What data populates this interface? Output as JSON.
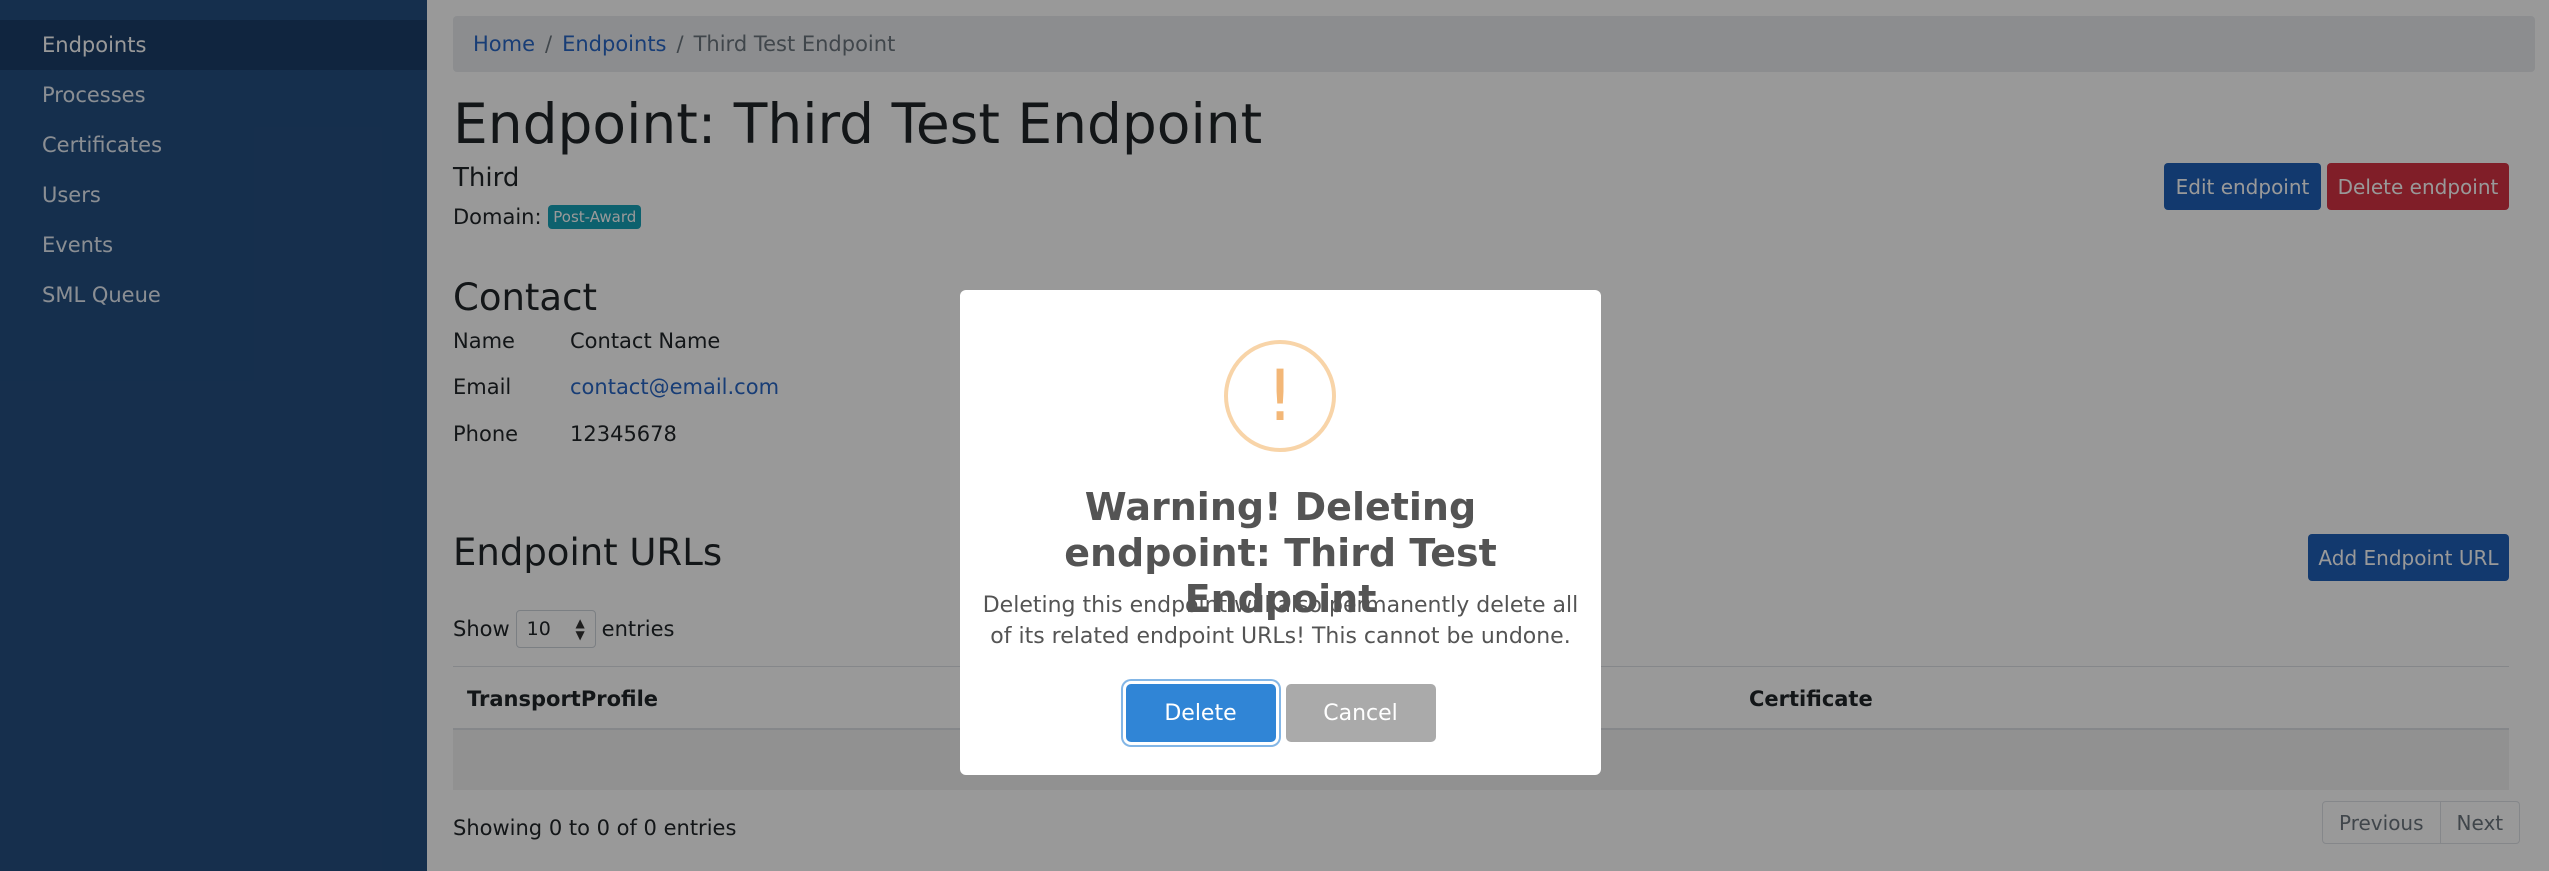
{
  "sidebar": {
    "items": [
      {
        "label": "Endpoints"
      },
      {
        "label": "Processes"
      },
      {
        "label": "Certificates"
      },
      {
        "label": "Users"
      },
      {
        "label": "Events"
      },
      {
        "label": "SML Queue"
      }
    ]
  },
  "breadcrumb": {
    "home": "Home",
    "endpoints": "Endpoints",
    "current": "Third Test Endpoint",
    "separator": "/"
  },
  "endpoint": {
    "title": "Endpoint: Third Test Endpoint",
    "subtitle": "Third",
    "domain_label": "Domain:",
    "domain_badge": "Post-Award",
    "edit_label": "Edit endpoint",
    "delete_label": "Delete endpoint"
  },
  "contact": {
    "heading": "Contact",
    "name_label": "Name",
    "name_value": "Contact Name",
    "email_label": "Email",
    "email_value": "contact@email.com",
    "phone_label": "Phone",
    "phone_value": "12345678"
  },
  "urls": {
    "heading": "Endpoint URLs",
    "add_label": "Add Endpoint URL",
    "show_label": "Show",
    "page_size": "10",
    "entries_label": "entries",
    "columns": [
      "TransportProfile",
      "Certificate"
    ],
    "info": "Showing 0 to 0 of 0 entries",
    "prev_label": "Previous",
    "next_label": "Next"
  },
  "modal": {
    "icon": "!",
    "title": "Warning! Deleting endpoint: Third Test Endpoint",
    "text": "Deleting this endpoint will also permanently delete all of its related endpoint URLs! This cannot be undone.",
    "confirm_label": "Delete",
    "cancel_label": "Cancel"
  },
  "colors": {
    "sidebar": "#244f80",
    "primary": "#1e5fb8",
    "danger": "#d63344",
    "confirm": "#3085d6",
    "warning": "#f3b777"
  }
}
